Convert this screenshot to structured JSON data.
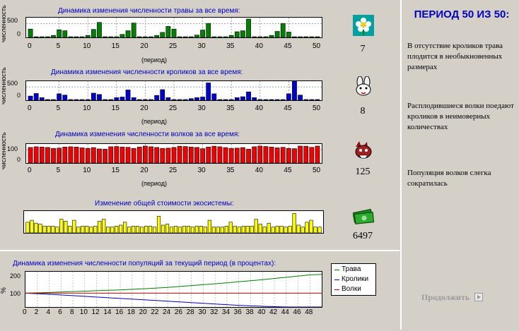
{
  "charts": {
    "grass": {
      "title": "Динамика изменения численности травы за все время:",
      "ylabel": "численность",
      "yticks": [
        "500",
        "0"
      ],
      "xlabel": "(период)",
      "count": "7"
    },
    "rabbits": {
      "title": "Динамика изменения численности кроликов за все время:",
      "ylabel": "численность",
      "yticks": [
        "500",
        "0"
      ],
      "xlabel": "(период)",
      "count": "8"
    },
    "wolves": {
      "title": "Динамика изменения численности волков за все время:",
      "ylabel": "численность",
      "yticks": [
        "100",
        "0"
      ],
      "xlabel": "(период)",
      "count": "125"
    },
    "value": {
      "title": "Изменение общей стоимости экосистемы:",
      "count": "6497"
    },
    "xticks": [
      "0",
      "5",
      "10",
      "15",
      "20",
      "25",
      "30",
      "35",
      "40",
      "45",
      "50"
    ]
  },
  "bottom": {
    "title": "Динамика изменения численности популяций за текущий период (в процентах):",
    "ylabel": "%",
    "yticks": [
      "200",
      "100"
    ],
    "xticks": [
      "0",
      "2",
      "4",
      "6",
      "8",
      "10",
      "12",
      "14",
      "16",
      "18",
      "20",
      "22",
      "24",
      "26",
      "28",
      "30",
      "32",
      "34",
      "36",
      "38",
      "40",
      "42",
      "44",
      "46",
      "48"
    ],
    "legend": [
      {
        "label": "Трава",
        "color": "#008000"
      },
      {
        "label": "Кролики",
        "color": "#0000c0"
      },
      {
        "label": "Волки",
        "color": "#c00000"
      }
    ]
  },
  "right": {
    "period_title": "ПЕРИОД 50 ИЗ 50:",
    "messages": [
      "В отсутствие кроликов трава плодится в необыкновенных размерах",
      "Расплодившиеся волки поедают кроликов в неимоверных количествах",
      "Популяция волков слегка сократилась"
    ],
    "continue_label": "Продолжить"
  },
  "colors": {
    "grass": "#008000",
    "rabbits": "#0000cc",
    "wolves": "#ee0000",
    "value": "#ffff00"
  },
  "chart_data": [
    {
      "type": "bar",
      "title": "Динамика изменения численности травы за все время:",
      "xlabel": "(период)",
      "ylabel": "численность",
      "ylim": [
        0,
        550
      ],
      "x": [
        0,
        1,
        2,
        3,
        4,
        5,
        6,
        7,
        8,
        9,
        10,
        11,
        12,
        13,
        14,
        15,
        16,
        17,
        18,
        19,
        20,
        21,
        22,
        23,
        24,
        25,
        26,
        27,
        28,
        29,
        30,
        31,
        32,
        33,
        34,
        35,
        36,
        37,
        38,
        39,
        40,
        41,
        42,
        43,
        44,
        45,
        46,
        47,
        48,
        49,
        50
      ],
      "values": [
        250,
        20,
        10,
        20,
        60,
        230,
        200,
        20,
        10,
        20,
        60,
        240,
        450,
        20,
        10,
        20,
        90,
        200,
        430,
        20,
        10,
        20,
        60,
        150,
        330,
        250,
        20,
        10,
        20,
        70,
        220,
        420,
        20,
        10,
        20,
        60,
        170,
        200,
        550,
        20,
        10,
        20,
        60,
        180,
        420,
        160,
        20,
        10,
        20,
        20,
        7
      ]
    },
    {
      "type": "bar",
      "title": "Динамика изменения численности кроликов за все время:",
      "xlabel": "(период)",
      "ylabel": "численность",
      "ylim": [
        0,
        550
      ],
      "x": [
        0,
        1,
        2,
        3,
        4,
        5,
        6,
        7,
        8,
        9,
        10,
        11,
        12,
        13,
        14,
        15,
        16,
        17,
        18,
        19,
        20,
        21,
        22,
        23,
        24,
        25,
        26,
        27,
        28,
        29,
        30,
        31,
        32,
        33,
        34,
        35,
        36,
        37,
        38,
        39,
        40,
        41,
        42,
        43,
        44,
        45,
        46,
        47,
        48,
        49,
        50
      ],
      "values": [
        130,
        210,
        80,
        10,
        10,
        200,
        160,
        10,
        10,
        10,
        10,
        220,
        180,
        10,
        10,
        80,
        100,
        320,
        80,
        10,
        10,
        10,
        150,
        330,
        80,
        10,
        10,
        10,
        50,
        80,
        100,
        540,
        200,
        10,
        10,
        10,
        80,
        110,
        260,
        80,
        10,
        10,
        10,
        10,
        10,
        200,
        610,
        160,
        10,
        10,
        8
      ]
    },
    {
      "type": "bar",
      "title": "Динамика изменения численности волков за все время:",
      "xlabel": "(период)",
      "ylabel": "численность",
      "ylim": [
        0,
        130
      ],
      "x": [
        0,
        1,
        2,
        3,
        4,
        5,
        6,
        7,
        8,
        9,
        10,
        11,
        12,
        13,
        14,
        15,
        16,
        17,
        18,
        19,
        20,
        21,
        22,
        23,
        24,
        25,
        26,
        27,
        28,
        29,
        30,
        31,
        32,
        33,
        34,
        35,
        36,
        37,
        38,
        39,
        40,
        41,
        42,
        43,
        44,
        45,
        46,
        47,
        48,
        49,
        50
      ],
      "values": [
        115,
        120,
        118,
        115,
        108,
        110,
        118,
        120,
        118,
        112,
        108,
        114,
        104,
        102,
        120,
        122,
        118,
        116,
        108,
        118,
        125,
        120,
        115,
        108,
        110,
        115,
        124,
        122,
        118,
        115,
        106,
        118,
        124,
        120,
        114,
        108,
        110,
        114,
        102,
        120,
        125,
        122,
        118,
        112,
        116,
        108,
        106,
        125,
        124,
        116,
        125
      ]
    },
    {
      "type": "bar",
      "title": "Изменение общей стоимости экосистемы:",
      "values": [
        11,
        13,
        10,
        9,
        7,
        7,
        7,
        6,
        14,
        12,
        7,
        13,
        6,
        7,
        7,
        6,
        7,
        12,
        14,
        6,
        6,
        7,
        8,
        11,
        6,
        7,
        7,
        6,
        7,
        7,
        6,
        17,
        8,
        9,
        6,
        7,
        6,
        7,
        7,
        6,
        7,
        7,
        6,
        13,
        6,
        6,
        6,
        7,
        11,
        7,
        6,
        7,
        7,
        7,
        14,
        9,
        6,
        10,
        6,
        7,
        7,
        6,
        7,
        20,
        8,
        6,
        11,
        13,
        6,
        6
      ],
      "ylim": [
        0,
        21
      ]
    },
    {
      "type": "line",
      "title": "Динамика изменения численности популяций за текущий период (в процентах):",
      "ylabel": "%",
      "x": [
        0,
        4,
        8,
        12,
        16,
        20,
        24,
        28,
        32,
        36,
        40,
        44,
        48,
        50
      ],
      "series": [
        {
          "name": "Трава",
          "values": [
            100,
            105,
            112,
            118,
            124,
            132,
            142,
            155,
            168,
            182,
            198,
            215,
            232,
            236
          ]
        },
        {
          "name": "Кролики",
          "values": [
            100,
            92,
            82,
            72,
            62,
            52,
            42,
            32,
            22,
            12,
            5,
            0,
            0,
            0
          ]
        },
        {
          "name": "Волки",
          "values": [
            100,
            100,
            100,
            100,
            100,
            100,
            100,
            100,
            100,
            100,
            100,
            100,
            100,
            100
          ]
        }
      ],
      "ylim": [
        0,
        245
      ]
    }
  ]
}
